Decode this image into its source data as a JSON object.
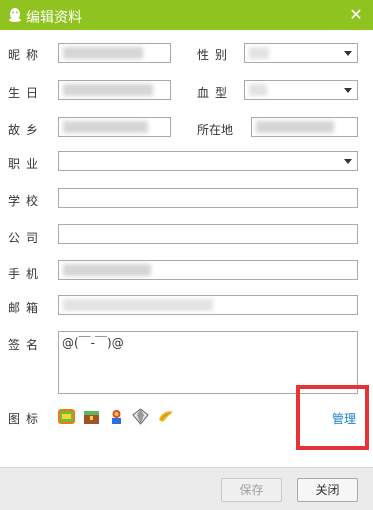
{
  "window": {
    "title": "编辑资料",
    "close_glyph": "✕",
    "accent_color": "#8fc31f"
  },
  "form": {
    "nickname_label": "昵称",
    "gender_label": "性别",
    "birthday_label": "生日",
    "blood_type_label": "血型",
    "hometown_label": "故乡",
    "location_label": "所在地",
    "job_label": "职业",
    "school_label": "学校",
    "company_label": "公司",
    "phone_label": "手机",
    "email_label": "邮箱",
    "signature_label": "签名",
    "signature_value": "@(￣-￣)@",
    "icons_label": "图标",
    "manage_link": "管理"
  },
  "icons": [
    "svip-icon",
    "treasure-chest-icon",
    "game-character-icon",
    "diamond-icon",
    "golden-wing-icon"
  ],
  "buttons": {
    "save": "保存",
    "close": "关闭"
  }
}
